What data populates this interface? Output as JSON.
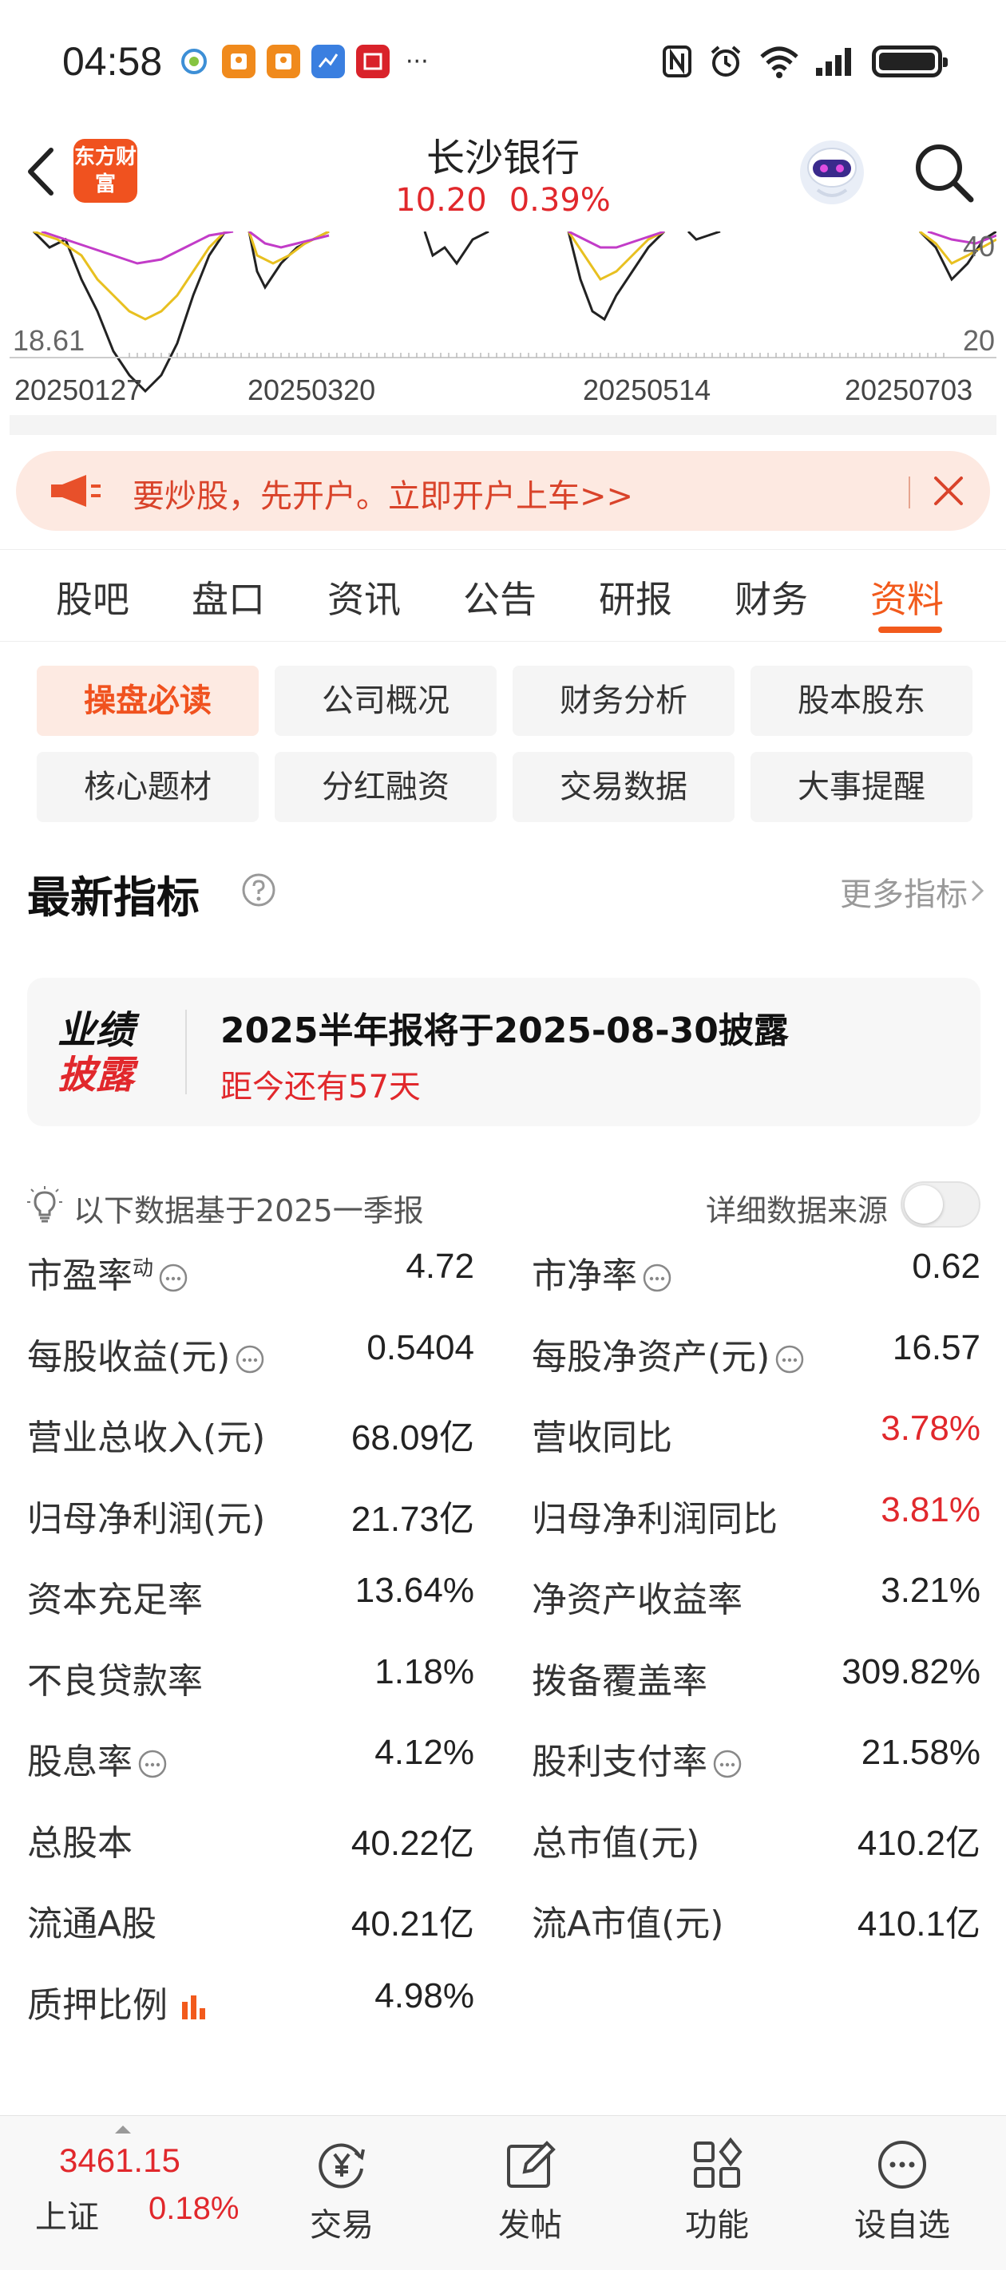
{
  "status_bar": {
    "time": "04:58",
    "more": "···",
    "app_icons": [
      "china-mobile-icon",
      "red-envelope-icon",
      "red-envelope-icon",
      "app-icon",
      "netease-icon"
    ]
  },
  "header": {
    "logo_text": "东方财富",
    "title": "长沙银行",
    "price": "10.20",
    "change_pct": "0.39%"
  },
  "chart": {
    "left_axis_value": "18.61",
    "right_top_value": "40",
    "right_bottom_value": "20",
    "dates": [
      "20250127",
      "20250320",
      "20250514",
      "20250703"
    ],
    "line_colors": [
      "#222222",
      "#e8c020",
      "#c23cc8"
    ]
  },
  "banner": {
    "text": "要炒股，先开户。立即开户上车>>"
  },
  "tabs": [
    "股吧",
    "盘口",
    "资讯",
    "公告",
    "研报",
    "财务",
    "资料"
  ],
  "active_tab": "资料",
  "sub_buttons": [
    "操盘必读",
    "公司概况",
    "财务分析",
    "股本股东",
    "核心题材",
    "分红融资",
    "交易数据",
    "大事提醒"
  ],
  "section": {
    "title": "最新指标",
    "more": "更多指标"
  },
  "disclosure": {
    "badge_line1": "业绩",
    "badge_line2": "披露",
    "title": "2025半年报将于2025-08-30披露",
    "countdown": "距今还有57天"
  },
  "basis": {
    "text": "以下数据基于2025一季报",
    "source_label": "详细数据来源"
  },
  "metrics": [
    {
      "label": "市盈率",
      "sup": "动",
      "value": "4.72",
      "info": true
    },
    {
      "label": "市净率",
      "value": "0.62",
      "info": true
    },
    {
      "label": "每股收益(元)",
      "value": "0.5404",
      "info": true
    },
    {
      "label": "每股净资产(元)",
      "value": "16.57",
      "info": true
    },
    {
      "label": "营业总收入(元)",
      "value": "68.09亿"
    },
    {
      "label": "营收同比",
      "value": "3.78%",
      "up": true
    },
    {
      "label": "归母净利润(元)",
      "value": "21.73亿"
    },
    {
      "label": "归母净利润同比",
      "value": "3.81%",
      "up": true
    },
    {
      "label": "资本充足率",
      "value": "13.64%"
    },
    {
      "label": "净资产收益率",
      "value": "3.21%"
    },
    {
      "label": "不良贷款率",
      "value": "1.18%"
    },
    {
      "label": "拨备覆盖率",
      "value": "309.82%"
    },
    {
      "label": "股息率",
      "value": "4.12%",
      "info": true
    },
    {
      "label": "股利支付率",
      "value": "21.58%",
      "info": true
    },
    {
      "label": "总股本",
      "value": "40.22亿"
    },
    {
      "label": "总市值(元)",
      "value": "410.2亿"
    },
    {
      "label": "流通A股",
      "value": "40.21亿"
    },
    {
      "label": "流A市值(元)",
      "value": "410.1亿"
    },
    {
      "label": "质押比例",
      "value": "4.98%",
      "bars": true
    }
  ],
  "bottom_nav": {
    "index_value": "3461.15",
    "index_name": "上证",
    "index_change": "0.18%",
    "items": [
      {
        "label": "交易",
        "icon": "yuan-cycle-icon"
      },
      {
        "label": "发帖",
        "icon": "edit-icon"
      },
      {
        "label": "功能",
        "icon": "grid-icon"
      },
      {
        "label": "设自选",
        "icon": "more-circle-icon"
      }
    ]
  },
  "colors": {
    "accent": "#f25a1c",
    "up_red": "#e1282c"
  }
}
